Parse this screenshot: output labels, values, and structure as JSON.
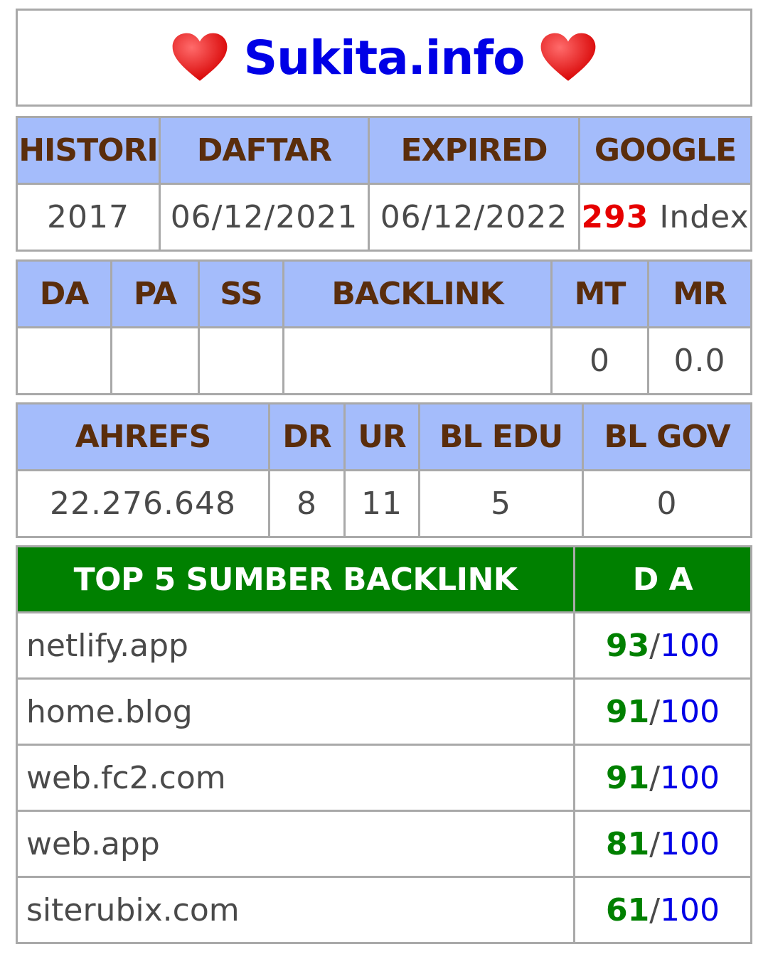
{
  "site": {
    "name": "Sukita.info"
  },
  "icons": {
    "heart": "heart-icon"
  },
  "colors": {
    "header_bg": "#a4bcfb",
    "header_text": "#5a2d0c",
    "green_header": "#008000",
    "red": "#e60000",
    "blue": "#0000e6"
  },
  "info": {
    "headers": [
      "HISTORI",
      "DAFTAR",
      "EXPIRED",
      "GOOGLE"
    ],
    "histori": "2017",
    "daftar": "06/12/2021",
    "expired": "06/12/2022",
    "google_count": "293",
    "google_suffix": "Index"
  },
  "moz": {
    "headers": [
      "DA",
      "PA",
      "SS",
      "BACKLINK",
      "MT",
      "MR"
    ],
    "values": [
      "",
      "",
      "",
      "",
      "0",
      "0.0"
    ]
  },
  "ahrefs": {
    "headers": [
      "AHREFS",
      "DR",
      "UR",
      "BL EDU",
      "BL GOV"
    ],
    "values": [
      "22.276.648",
      "8",
      "11",
      "5",
      "0"
    ]
  },
  "backlinks": {
    "header_source": "TOP 5 SUMBER BACKLINK",
    "header_da": "D A",
    "rows": [
      {
        "source": "netlify.app",
        "da": "93",
        "max": "100"
      },
      {
        "source": "home.blog",
        "da": "91",
        "max": "100"
      },
      {
        "source": "web.fc2.com",
        "da": "91",
        "max": "100"
      },
      {
        "source": "web.app",
        "da": "81",
        "max": "100"
      },
      {
        "source": "siterubix.com",
        "da": "61",
        "max": "100"
      }
    ]
  }
}
